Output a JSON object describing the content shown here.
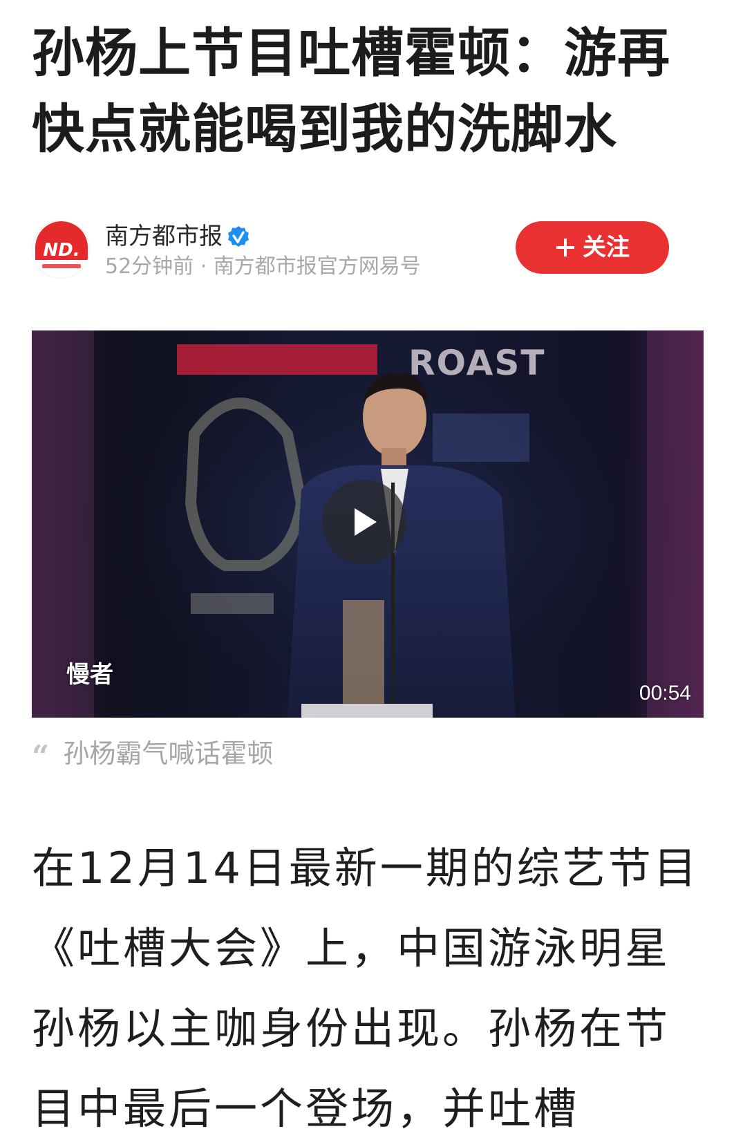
{
  "article": {
    "title": "孙杨上节目吐槽霍顿：游再快点就能喝到我的洗脚水",
    "author": {
      "name": "南方都市报",
      "meta": "52分钟前 · 南方都市报官方网易号",
      "avatar_text": "ND."
    },
    "follow_button": {
      "label": "关注",
      "color": "#ea3131"
    },
    "video": {
      "duration": "00:54",
      "watermark": "慢者",
      "backdrop_text": "ROAST"
    },
    "caption": "孙杨霸气喊话霍顿",
    "body": "在12月14日最新一期的综艺节目《吐槽大会》上，中国游泳明星孙杨以主咖身份出现。孙杨在节目中最后一个登场，并吐槽"
  },
  "icons": {
    "verified": "verified-badge-icon",
    "plus": "plus-icon",
    "play": "play-icon",
    "quote": "quote-icon"
  },
  "colors": {
    "accent_red": "#ea3131",
    "verified_blue": "#1f8ef1",
    "meta_gray": "#a8a8a8"
  }
}
